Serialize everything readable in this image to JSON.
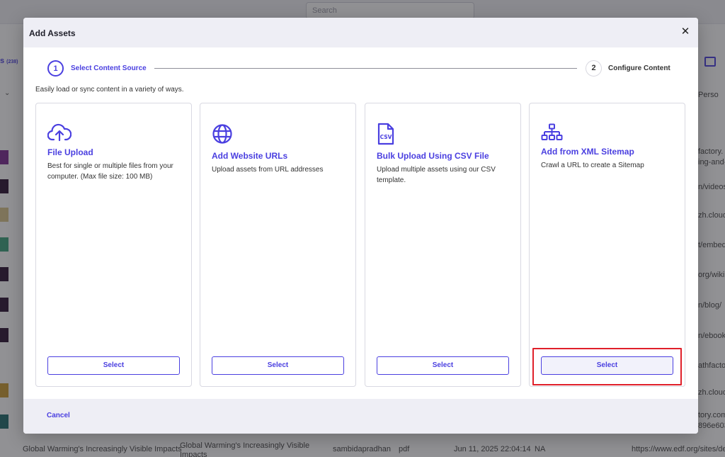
{
  "background": {
    "search_placeholder": "Search",
    "tab_label": "s",
    "tab_count": "(238)",
    "right_column_header": "Perso",
    "right_column_rows": [
      "factory.",
      "ing-and-",
      "n/videos",
      "zh.cloud",
      "t/embed",
      "org/wiki",
      "n/blog/",
      "n/ebook",
      "athfactor",
      "zh.cloud",
      "tory.com/",
      "896e603"
    ],
    "bottom_row": {
      "name": "Global Warming's Increasingly Visible Impacts",
      "title_line1": "Global Warming's Increasingly Visible",
      "title_line2": "Impacts",
      "user": "sambidapradhan",
      "type": "pdf",
      "date": "Jun 11, 2025 22:04:14",
      "na": "NA",
      "url": "https://www.edf.org/sites/de"
    }
  },
  "modal": {
    "title": "Add Assets",
    "close_icon": "close-icon",
    "stepper": {
      "steps": [
        {
          "number": "1",
          "label": "Select Content Source",
          "active": true
        },
        {
          "number": "2",
          "label": "Configure Content",
          "active": false
        }
      ]
    },
    "subtitle": "Easily load or sync content in a variety of ways.",
    "cards": [
      {
        "icon": "cloud-upload-icon",
        "title": "File Upload",
        "description": "Best for single or multiple files from your computer. (Max file size: 100 MB)",
        "button": "Select"
      },
      {
        "icon": "globe-icon",
        "title": "Add Website URLs",
        "description": "Upload assets from URL addresses",
        "button": "Select"
      },
      {
        "icon": "csv-file-icon",
        "title": "Bulk Upload Using CSV File",
        "description": "Upload multiple assets using our CSV template.",
        "button": "Select"
      },
      {
        "icon": "sitemap-icon",
        "title": "Add from XML Sitemap",
        "description": "Crawl a URL to create a Sitemap",
        "button": "Select"
      }
    ],
    "footer": {
      "cancel": "Cancel"
    }
  },
  "colors": {
    "accent": "#4a3fe0",
    "highlight": "#e0202a",
    "header_bg": "#eeeef5"
  }
}
